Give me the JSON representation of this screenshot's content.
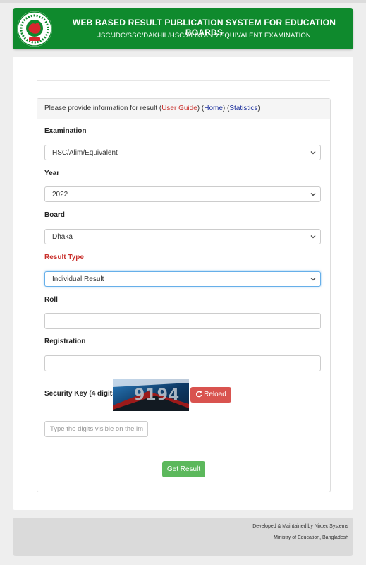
{
  "header": {
    "title": "WEB BASED RESULT PUBLICATION SYSTEM FOR EDUCATION BOARDS",
    "subtitle": "JSC/JDC/SSC/DAKHIL/HSC/ALIM AND EQUIVALENT EXAMINATION",
    "color": "#0f8a2d"
  },
  "panel": {
    "intro": "Please provide information for result",
    "link_user_guide": "User Guide",
    "link_home": "Home",
    "link_statistics": "Statistics"
  },
  "form": {
    "examination_label": "Examination",
    "examination_value": "HSC/Alim/Equivalent",
    "year_label": "Year",
    "year_value": "2022",
    "board_label": "Board",
    "board_value": "Dhaka",
    "result_type_label": "Result Type",
    "result_type_value": "Individual Result",
    "roll_label": "Roll",
    "roll_value": "",
    "registration_label": "Registration",
    "registration_value": "",
    "security_key_label": "Security Key (4 digits)",
    "captcha_digits": "9194",
    "reload_label": "Reload",
    "security_key_placeholder": "Type the digits visible on the im",
    "submit_label": "Get Result"
  },
  "footer": {
    "line1": "Developed & Maintained by Nixtec Systems",
    "line2": "Ministry of Education, Bangladesh"
  },
  "colors": {
    "danger": "#d9534f",
    "success": "#5cb85c",
    "link_red": "#c9302c",
    "link_blue": "#1a2e9c"
  },
  "icons": {
    "logo": "government-seal-icon",
    "dropdown": "chevron-down-icon",
    "reload": "refresh-icon"
  }
}
